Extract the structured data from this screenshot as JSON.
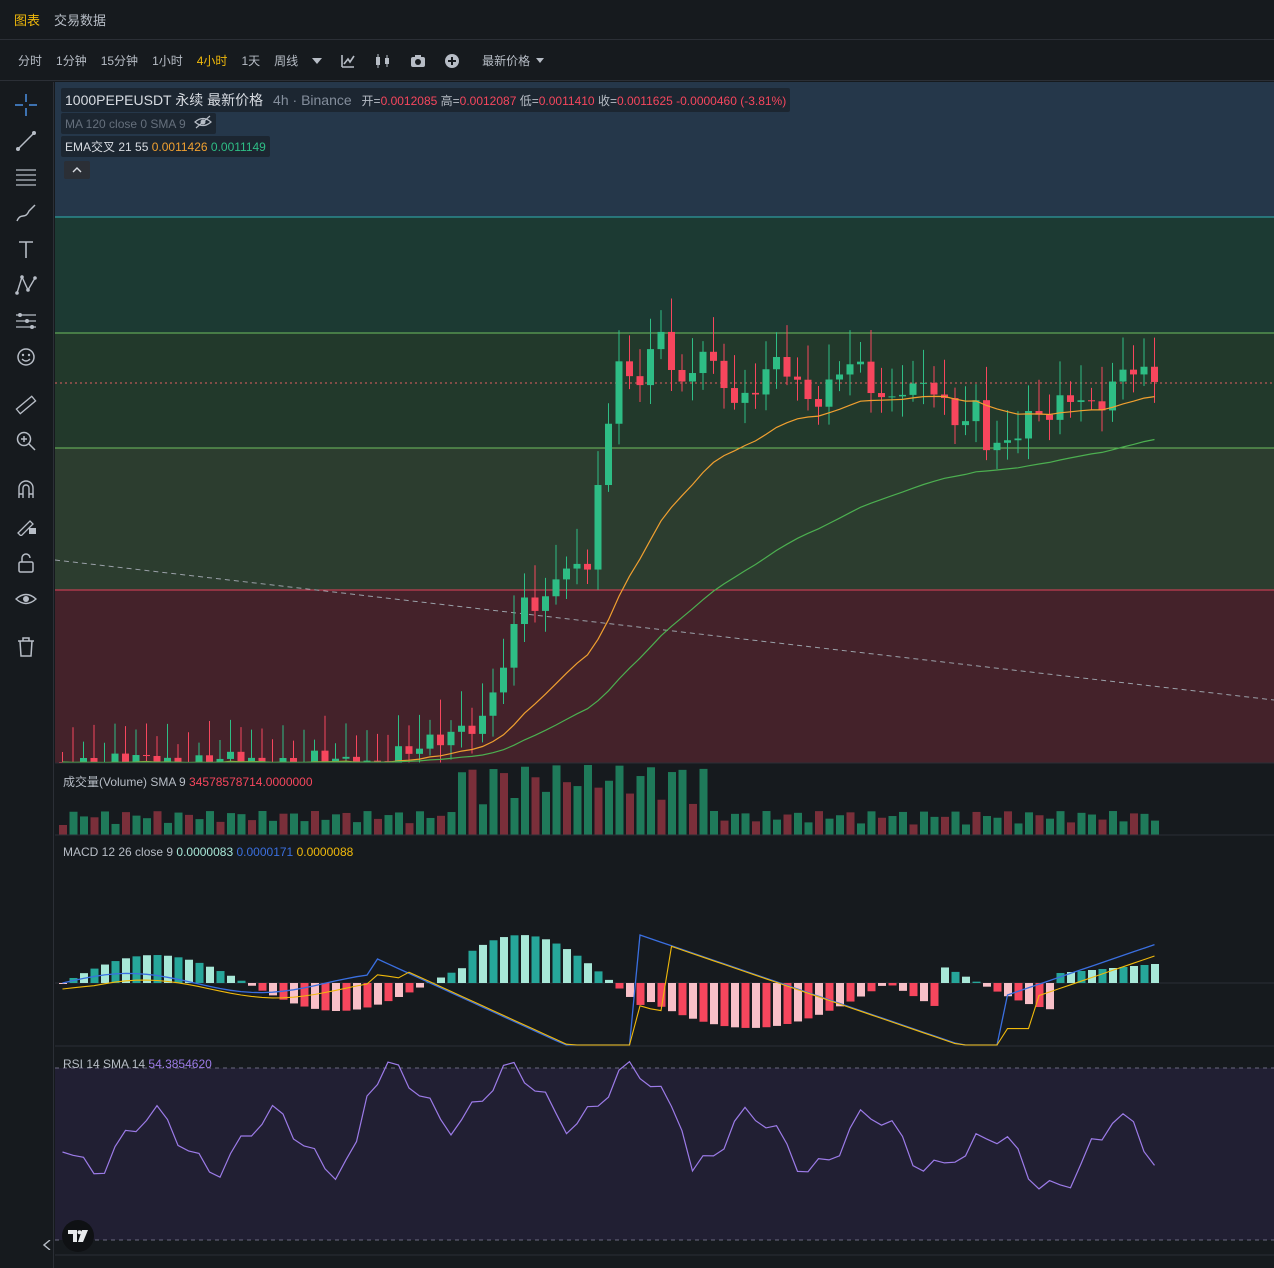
{
  "top_tabs": [
    "图表",
    "交易数据"
  ],
  "intervals": [
    "分时",
    "1分钟",
    "15分钟",
    "1小时",
    "4小时",
    "1天",
    "周线"
  ],
  "active_interval": "4小时",
  "price_select": "最新价格",
  "legend": {
    "symbol": "1000PEPEUSDT 永续 最新价格",
    "interval": "4h",
    "exchange": "Binance",
    "open_label": "开=",
    "open": "0.0012085",
    "high_label": "高=",
    "high": "0.0012087",
    "low_label": "低=",
    "low": "0.0011410",
    "close_label": "收=",
    "close": "0.0011625",
    "change": "-0.0000460 (-3.81%)",
    "ma_line": "MA 120 close 0 SMA 9",
    "ema_title": "EMA交叉 21 55",
    "ema_fast": "0.0011426",
    "ema_slow": "0.0011149"
  },
  "volume_legend": {
    "title": "成交量(Volume) SMA 9",
    "value": "34578578714.0000000"
  },
  "macd_legend": {
    "title": "MACD 12 26 close 9",
    "hist": "0.0000083",
    "macd": "0.0000171",
    "signal": "0.0000088"
  },
  "rsi_legend": {
    "title": "RSI 14 SMA 14",
    "value": "54.3854620"
  },
  "colors": {
    "up": "#2ebd85",
    "down": "#f6465d",
    "ema_fast": "#f0a030",
    "ema_slow": "#4caf50",
    "macd_line": "#3a6fe0",
    "signal_line": "#f0b90b",
    "rsi_line": "#9c7be8",
    "accent": "#f0b90b"
  },
  "chart_data": {
    "type": "candlestick",
    "interval": "4h",
    "series_count": 105
  }
}
